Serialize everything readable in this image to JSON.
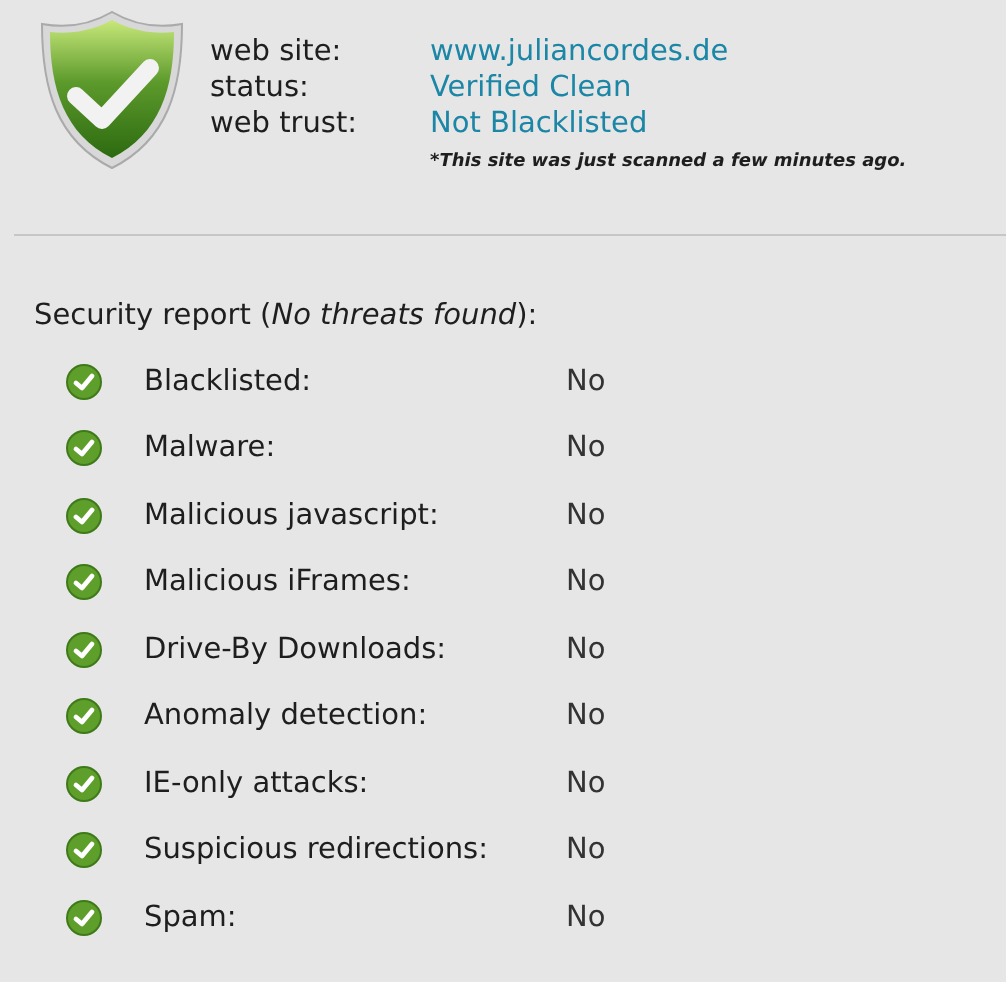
{
  "site_info": [
    {
      "label": "web site:",
      "value": "www.juliancordes.de"
    },
    {
      "label": "status:",
      "value": "Verified Clean"
    },
    {
      "label": "web trust:",
      "value": "Not Blacklisted"
    }
  ],
  "scan_note": "*This site was just scanned a few minutes ago.",
  "report": {
    "title": "Security report (*No threats found*):",
    "items": [
      {
        "label": "Blacklisted:",
        "value": "No"
      },
      {
        "label": "Malware:",
        "value": "No"
      },
      {
        "label": "Malicious javascript:",
        "value": "No"
      },
      {
        "label": "Malicious iFrames:",
        "value": "No"
      },
      {
        "label": "Drive-By Downloads:",
        "value": "No"
      },
      {
        "label": "Anomaly detection:",
        "value": "No"
      },
      {
        "label": "IE-only attacks:",
        "value": "No"
      },
      {
        "label": "Suspicious redirections:",
        "value": "No"
      },
      {
        "label": "Spam:",
        "value": "No"
      }
    ]
  }
}
